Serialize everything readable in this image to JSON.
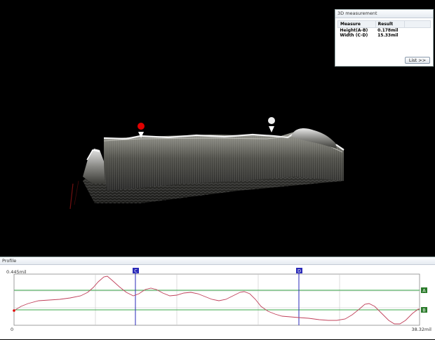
{
  "measurement_panel": {
    "title": "3D measurement",
    "columns": [
      "Measure",
      "Result"
    ],
    "rows": [
      {
        "measure": "Height(A-B)",
        "result": "0.178mil"
      },
      {
        "measure": "Width (C-D)",
        "result": "15.33mil"
      }
    ],
    "list_button": "List >>"
  },
  "profile_panel": {
    "title": "Profile",
    "y_max_label": "0.445mil",
    "x_min_label": "0",
    "x_max_label": "38.32mil",
    "marker_c": "C",
    "marker_d": "D",
    "line_a": "A",
    "line_b": "B"
  },
  "colors": {
    "profile_line": "#c0405a",
    "ab_lines": "#3aa84a",
    "cd_markers": "#2a2ab8",
    "marker_red": "#e00000",
    "marker_white": "#f0f0f0"
  }
}
